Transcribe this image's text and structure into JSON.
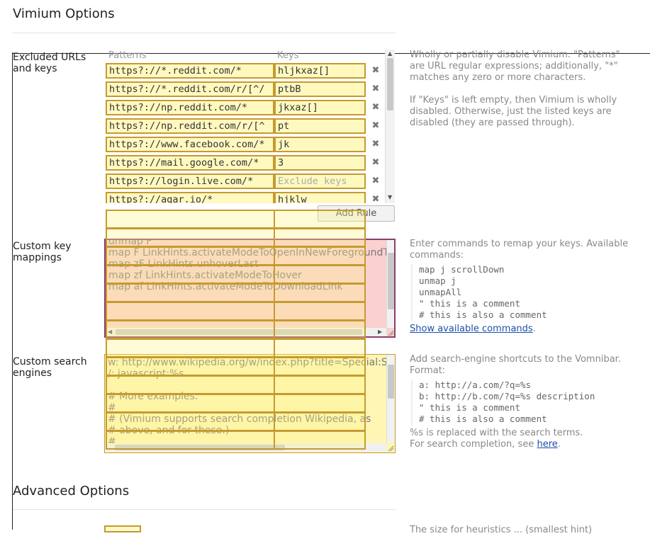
{
  "page": {
    "title": "Vimium Options"
  },
  "exclusions": {
    "label": "Excluded URLs and keys",
    "col_patterns": "Patterns",
    "col_keys": "Keys",
    "remove_icon": "close-icon",
    "rows": [
      {
        "pattern": "https?://*.reddit.com/*",
        "keys": "hljkxaz[]"
      },
      {
        "pattern": "https?://*.reddit.com/r/[^/",
        "keys": "ptbB"
      },
      {
        "pattern": "https?://np.reddit.com/*",
        "keys": "jkxaz[]"
      },
      {
        "pattern": "https?://np.reddit.com/r/[^",
        "keys": "pt"
      },
      {
        "pattern": "https?://www.facebook.com/*",
        "keys": "jk"
      },
      {
        "pattern": "https?://mail.google.com/*",
        "keys": "3"
      },
      {
        "pattern": "https?://login.live.com/*",
        "keys": ""
      },
      {
        "pattern": "https?://agar.io/*",
        "keys": "hjklw"
      }
    ],
    "keys_placeholder": "Exclude keys",
    "add_rule": "Add Rule",
    "help1": "Wholly or partially disable Vimium. \"Patterns\" are URL regular expressions; additionally, \"*\" matches any zero or more characters.",
    "help2": "If \"Keys\" is left empty, then Vimium is wholly disabled. Otherwise, just the listed keys are disabled (they are passed through)."
  },
  "keymappings": {
    "label": "Custom key mappings",
    "lines": [
      "unmap F",
      "map F LinkHints.activateModeToOpenInNewForegroundTab",
      "map zF LinkHints.unhoverLast",
      "map zf LinkHints.activateModeToHover",
      "map af LinkHints.activateModeToDownloadLink"
    ],
    "help_intro": "Enter commands to remap your keys. Available commands:",
    "help_code": [
      "map j scrollDown",
      "unmap j",
      "unmapAll",
      "\" this is a comment",
      "# this is also a comment"
    ],
    "show_commands": "Show available commands",
    "show_commands_suffix": "."
  },
  "searchengines": {
    "label": "Custom search engines",
    "lines": [
      "w: http://www.wikipedia.org/w/index.php?title=Special:Search&search=%s",
      "/: javascript:%s",
      "",
      "# More examples.",
      "#",
      "# (Vimium supports search completion Wikipedia, as",
      "# above, and for these.)",
      "#"
    ],
    "help_intro": "Add search-engine shortcuts to the Vomnibar. Format:",
    "help_code": [
      "a: http://a.com/?q=%s",
      "b: http://b.com/?q=%s description",
      "\" this is a comment",
      "# this is also a comment"
    ],
    "help_after": "%s is replaced with the search terms.",
    "help_completion": "For search completion, see",
    "here": "here",
    "here_suffix": "."
  },
  "advanced": {
    "title": "Advanced Options",
    "cutoff_text": "The size for heuristics ... (smallest hint)"
  }
}
